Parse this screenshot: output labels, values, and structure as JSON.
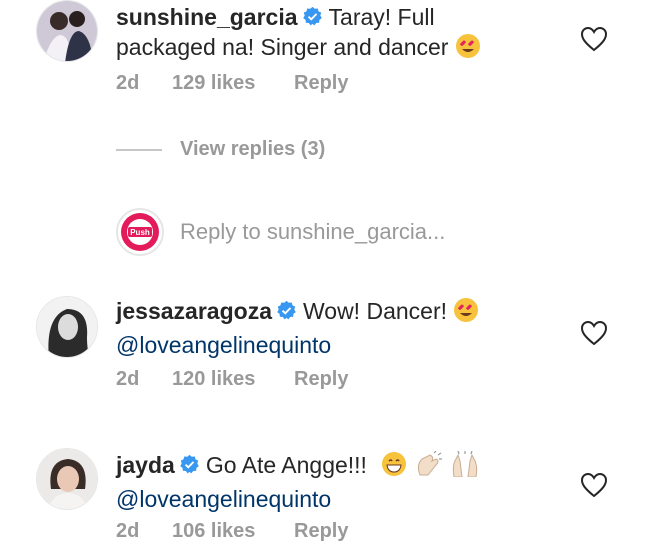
{
  "comments": [
    {
      "username": "sunshine_garcia",
      "text": "Taray! Full packaged na! Singer and dancer",
      "mention": "",
      "time": "2d",
      "likes": "129 likes",
      "reply_label": "Reply"
    },
    {
      "username": "jessazaragoza",
      "text": "Wow! Dancer!",
      "mention": "@loveangelinequinto",
      "time": "2d",
      "likes": "120 likes",
      "reply_label": "Reply"
    },
    {
      "username": "jayda",
      "text": "Go Ate Angge!!!",
      "mention": "@loveangelinequinto",
      "time": "2d",
      "likes": "106 likes",
      "reply_label": "Reply"
    }
  ],
  "view_replies": "View replies (3)",
  "reply_input": {
    "placeholder": "Reply to sunshine_garcia...",
    "avatar_text": "Push"
  },
  "colors": {
    "verified": "#3897f0",
    "meta": "#999999",
    "mention": "#003569"
  },
  "icons": {
    "verified": "verified-badge-icon",
    "heart": "heart-outline-icon"
  }
}
